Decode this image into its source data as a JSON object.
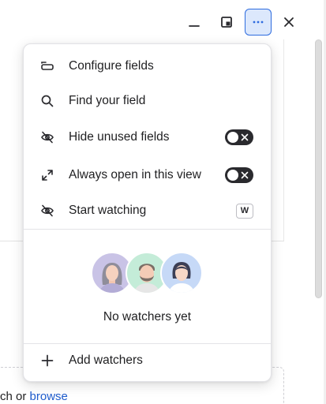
{
  "window_controls": {
    "minimize_icon": "minimize-icon",
    "panel_icon": "panel-icon",
    "more_icon": "more-horizontal-icon",
    "close_icon": "close-icon"
  },
  "menu": {
    "items": [
      {
        "label": "Configure fields",
        "icon": "configure-fields-icon"
      },
      {
        "label": "Find your field",
        "icon": "search-icon"
      },
      {
        "label": "Hide unused fields",
        "icon": "eye-off-icon",
        "toggle": "off"
      },
      {
        "label": "Always open in this view",
        "icon": "expand-icon",
        "toggle": "off"
      },
      {
        "label": "Start watching",
        "icon": "eye-off-icon",
        "shortcut": "W"
      }
    ],
    "watchers": {
      "empty_text": "No watchers yet",
      "avatar_colors": [
        "#c9c3e6",
        "#c4ecd8",
        "#c6d9f7"
      ]
    },
    "add_watchers_label": "Add watchers"
  },
  "background": {
    "drop_text_prefix": "ch or",
    "drop_link": "browse"
  },
  "colors": {
    "accent": "#2e6cdf",
    "accent_bg": "#dce8fc",
    "link": "#1f5ccc",
    "toggle_bg": "#2a2a2e"
  }
}
